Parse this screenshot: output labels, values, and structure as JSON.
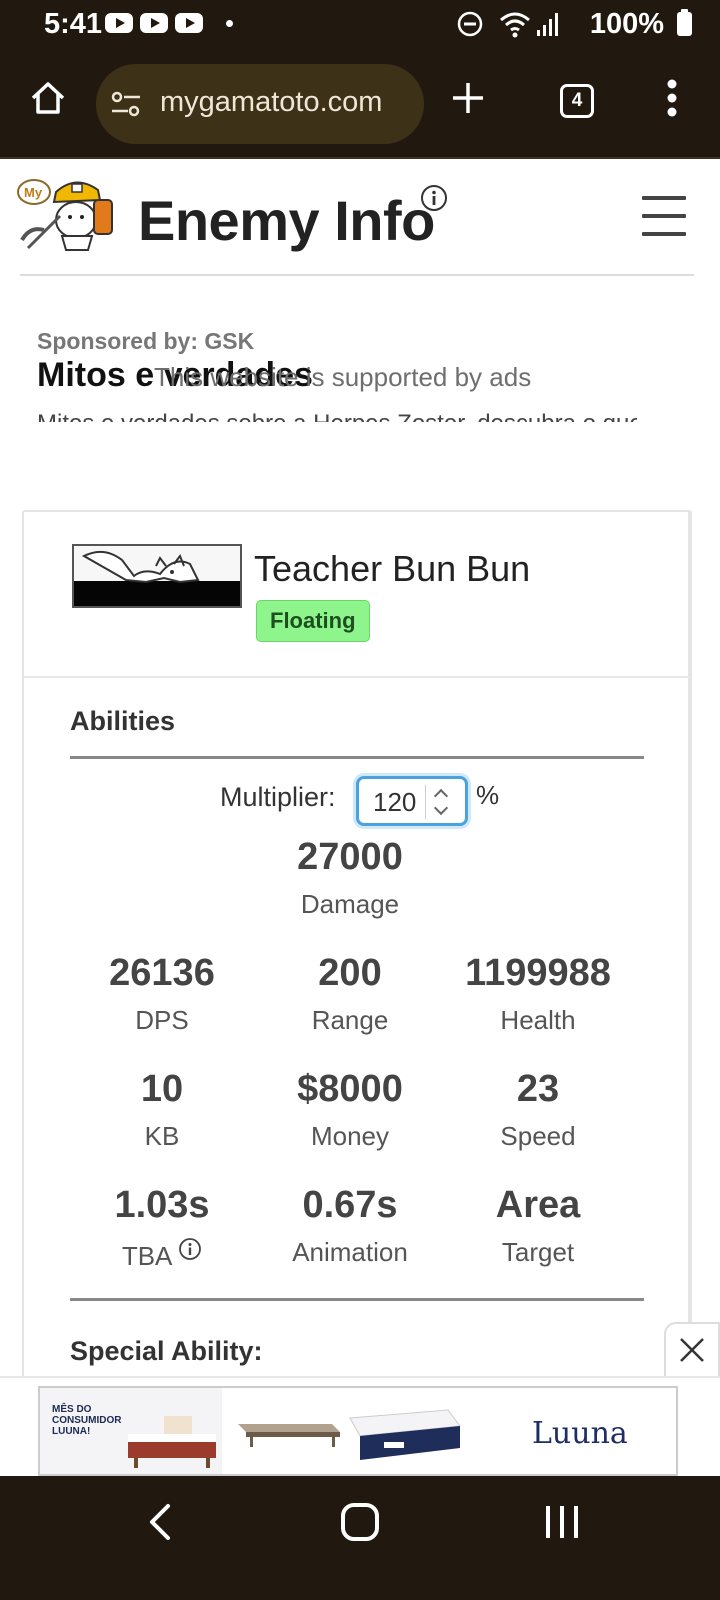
{
  "status_bar": {
    "time": "5:41",
    "battery": "100%"
  },
  "browser": {
    "url": "mygamatoto.com",
    "tab_count": "4"
  },
  "site": {
    "logo_text": "My",
    "page_title": "Enemy Info"
  },
  "ad": {
    "sponsor": "Sponsored by: GSK",
    "headline": "Mitos e verdades",
    "support_text": "This website is supported by ads",
    "snippet": "Mitos e verdades sobre a Herpes Zoster, descubra o que pode"
  },
  "enemy": {
    "name": "Teacher Bun Bun",
    "trait": "Floating",
    "abilities_title": "Abilities",
    "multiplier_label": "Multiplier:",
    "multiplier_value": "120",
    "percent": "%",
    "stats": {
      "damage": {
        "value": "27000",
        "label": "Damage"
      },
      "dps": {
        "value": "26136",
        "label": "DPS"
      },
      "range": {
        "value": "200",
        "label": "Range"
      },
      "health": {
        "value": "1199988",
        "label": "Health"
      },
      "kb": {
        "value": "10",
        "label": "KB"
      },
      "money": {
        "value": "$8000",
        "label": "Money"
      },
      "speed": {
        "value": "23",
        "label": "Speed"
      },
      "tba": {
        "value": "1.03s",
        "label": "TBA"
      },
      "animation": {
        "value": "0.67s",
        "label": "Animation"
      },
      "target": {
        "value": "Area",
        "label": "Target"
      }
    },
    "special_title": "Special Ability:"
  },
  "sticky_ad": {
    "promo_text": "MÊS DO CONSUMIDOR LUUNA!",
    "brand": "Luuna"
  }
}
